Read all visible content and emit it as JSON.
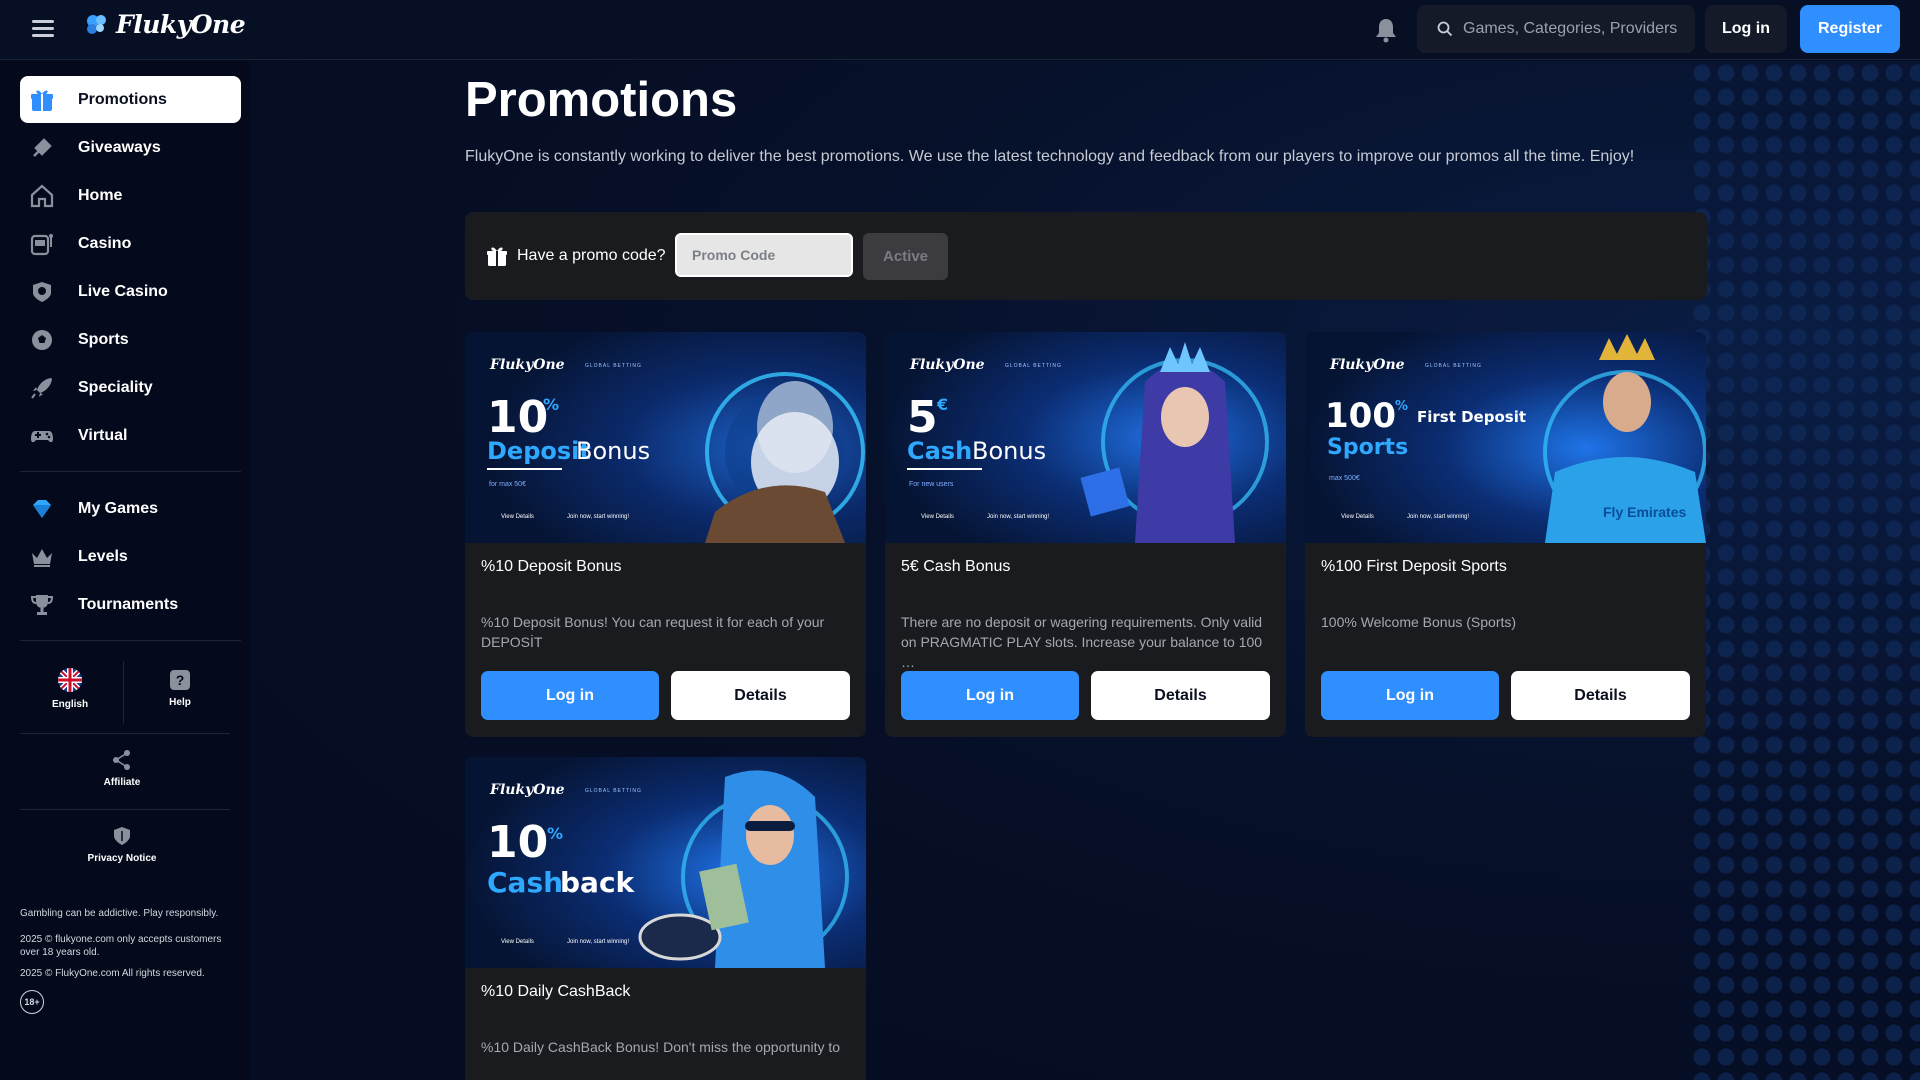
{
  "header": {
    "brand": "FlukyOne",
    "search_placeholder": "Games, Categories, Providers",
    "login_label": "Log in",
    "register_label": "Register"
  },
  "sidebar": {
    "items": [
      {
        "label": "Promotions",
        "icon": "gift-icon",
        "active": true
      },
      {
        "label": "Giveaways",
        "icon": "rocket-sparkle-icon"
      },
      {
        "label": "Home",
        "icon": "home-icon"
      },
      {
        "label": "Casino",
        "icon": "slot-machine-icon"
      },
      {
        "label": "Live Casino",
        "icon": "live-casino-chip-icon"
      },
      {
        "label": "Sports",
        "icon": "soccer-ball-icon"
      },
      {
        "label": "Speciality",
        "icon": "rocket-icon"
      },
      {
        "label": "Virtual",
        "icon": "gamepad-icon"
      },
      {
        "label": "My Games",
        "icon": "diamond-icon"
      },
      {
        "label": "Levels",
        "icon": "crown-icon"
      },
      {
        "label": "Tournaments",
        "icon": "trophy-icon"
      }
    ],
    "language": "English",
    "help": "Help",
    "affiliate": "Affiliate",
    "privacy": "Privacy Notice",
    "footer": {
      "responsible": "Gambling can be addictive. Play responsibly.",
      "age_notice": "2025 © flukyone.com only accepts customers over 18 years old.",
      "rights": "2025 © FlukyOne.com All rights reserved.",
      "age_badge": "18+"
    }
  },
  "main": {
    "title": "Promotions",
    "description": "FlukyOne is constantly working to deliver the best promotions. We use the latest technology and feedback from our players to improve our promos all the time. Enjoy!",
    "promo": {
      "label": "Have a promo code?",
      "placeholder": "Promo Code",
      "button": "Active"
    },
    "cards": [
      {
        "title": "%10 Deposit Bonus",
        "description": "%10 Deposit Bonus! You can request it for each of your DEPOSİT",
        "login_label": "Log in",
        "details_label": "Details",
        "banner": {
          "big": "10",
          "sup": "%",
          "line1": "Deposit",
          "line1b": "Bonus",
          "note": "for max 50€",
          "view": "View Details",
          "tag": "Join now, start winning!"
        }
      },
      {
        "title": "5€ Cash Bonus",
        "description": "There are no deposit or wagering requirements. Only valid on PRAGMATIC PLAY slots. Increase your balance to 100 …",
        "login_label": "Log in",
        "details_label": "Details",
        "banner": {
          "big": "5",
          "sup": "€",
          "line1": "Cash",
          "line1b": "Bonus",
          "note": "For new users",
          "view": "View Details",
          "tag": "Join now, start winning!"
        }
      },
      {
        "title": "%100 First Deposit Sports",
        "description": "100% Welcome Bonus (Sports)",
        "login_label": "Log in",
        "details_label": "Details",
        "banner": {
          "big": "100",
          "sup": "%",
          "line1": "Sports",
          "line1b": "First Deposit",
          "note": "max 500€",
          "view": "View Details",
          "tag": "Join now, start winning!",
          "shirt": "Fly Emirates"
        }
      },
      {
        "title": "%10 Daily CashBack",
        "description": "%10 Daily CashBack Bonus! Don't miss the opportunity to",
        "banner": {
          "big": "10",
          "sup": "%",
          "line1": "Cash",
          "line1b": "back",
          "view": "View Details",
          "tag": "Join now, start winning!"
        }
      }
    ],
    "banner_brand": "FlukyOne",
    "banner_sub": "GLOBAL BETTING"
  },
  "colors": {
    "accent": "#2f8fff",
    "background": "#050d22",
    "card": "#1a1b1f"
  }
}
